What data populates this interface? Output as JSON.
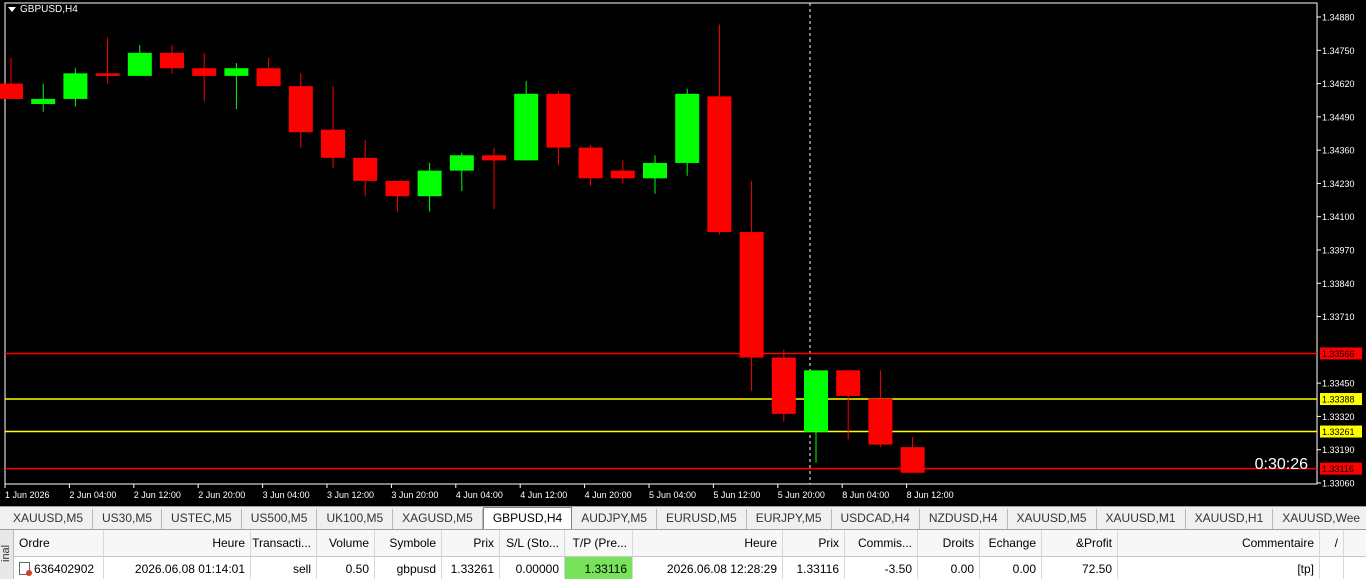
{
  "chart": {
    "title": "GBPUSD,H4",
    "timer": "0:30:26",
    "colors": {
      "bull": "#00ff00",
      "bear": "#ff0000",
      "background": "#000000",
      "grid": "#ffffff"
    }
  },
  "chart_data": {
    "type": "candlestick",
    "symbol": "GBPUSD",
    "timeframe": "H4",
    "ylim": [
      1.3306,
      1.3488
    ],
    "y_ticks": [
      "1.34880",
      "1.34750",
      "1.34620",
      "1.34490",
      "1.34360",
      "1.34230",
      "1.34100",
      "1.33970",
      "1.33840",
      "1.33710",
      "1.33450",
      "1.33320",
      "1.33190",
      "1.33060"
    ],
    "x_tick_labels": [
      {
        "label": "1 Jun 2026",
        "index": 0
      },
      {
        "label": "2 Jun 04:00",
        "index": 2
      },
      {
        "label": "2 Jun 12:00",
        "index": 4
      },
      {
        "label": "2 Jun 20:00",
        "index": 6
      },
      {
        "label": "3 Jun 04:00",
        "index": 8
      },
      {
        "label": "3 Jun 12:00",
        "index": 10
      },
      {
        "label": "3 Jun 20:00",
        "index": 12
      },
      {
        "label": "4 Jun 04:00",
        "index": 14
      },
      {
        "label": "4 Jun 12:00",
        "index": 16
      },
      {
        "label": "4 Jun 20:00",
        "index": 18
      },
      {
        "label": "5 Jun 04:00",
        "index": 20
      },
      {
        "label": "5 Jun 12:00",
        "index": 22
      },
      {
        "label": "5 Jun 20:00",
        "index": 24
      },
      {
        "label": "8 Jun 04:00",
        "index": 26
      },
      {
        "label": "8 Jun 12:00",
        "index": 28
      }
    ],
    "candles": [
      {
        "o": 1.3462,
        "h": 1.3472,
        "l": 1.3456,
        "c": 1.3456
      },
      {
        "o": 1.3454,
        "h": 1.3462,
        "l": 1.3451,
        "c": 1.3456
      },
      {
        "o": 1.3456,
        "h": 1.3468,
        "l": 1.3453,
        "c": 1.3466
      },
      {
        "o": 1.3466,
        "h": 1.348,
        "l": 1.3462,
        "c": 1.3465
      },
      {
        "o": 1.3465,
        "h": 1.3477,
        "l": 1.3465,
        "c": 1.3474
      },
      {
        "o": 1.3474,
        "h": 1.3477,
        "l": 1.3466,
        "c": 1.3468
      },
      {
        "o": 1.3468,
        "h": 1.3474,
        "l": 1.3455,
        "c": 1.3465
      },
      {
        "o": 1.3465,
        "h": 1.347,
        "l": 1.3452,
        "c": 1.3468
      },
      {
        "o": 1.3468,
        "h": 1.3472,
        "l": 1.3461,
        "c": 1.3461
      },
      {
        "o": 1.3461,
        "h": 1.3466,
        "l": 1.3437,
        "c": 1.3443
      },
      {
        "o": 1.3444,
        "h": 1.3461,
        "l": 1.3429,
        "c": 1.3433
      },
      {
        "o": 1.3433,
        "h": 1.344,
        "l": 1.3418,
        "c": 1.3424
      },
      {
        "o": 1.3424,
        "h": 1.3424,
        "l": 1.3412,
        "c": 1.3418
      },
      {
        "o": 1.3418,
        "h": 1.3431,
        "l": 1.3412,
        "c": 1.3428
      },
      {
        "o": 1.3428,
        "h": 1.3435,
        "l": 1.342,
        "c": 1.3434
      },
      {
        "o": 1.3434,
        "h": 1.3437,
        "l": 1.3413,
        "c": 1.3432
      },
      {
        "o": 1.3432,
        "h": 1.3463,
        "l": 1.3432,
        "c": 1.3458
      },
      {
        "o": 1.3458,
        "h": 1.3459,
        "l": 1.343,
        "c": 1.3437
      },
      {
        "o": 1.3437,
        "h": 1.3438,
        "l": 1.3422,
        "c": 1.3425
      },
      {
        "o": 1.3428,
        "h": 1.3432,
        "l": 1.3423,
        "c": 1.3425
      },
      {
        "o": 1.3425,
        "h": 1.3434,
        "l": 1.3419,
        "c": 1.3431
      },
      {
        "o": 1.3431,
        "h": 1.346,
        "l": 1.3426,
        "c": 1.3458
      },
      {
        "o": 1.3457,
        "h": 1.3485,
        "l": 1.3403,
        "c": 1.3404
      },
      {
        "o": 1.3404,
        "h": 1.3424,
        "l": 1.3342,
        "c": 1.3355
      },
      {
        "o": 1.3355,
        "h": 1.3358,
        "l": 1.333,
        "c": 1.3333
      },
      {
        "o": 1.3326,
        "h": 1.335,
        "l": 1.3314,
        "c": 1.335
      },
      {
        "o": 1.335,
        "h": 1.335,
        "l": 1.3323,
        "c": 1.334
      },
      {
        "o": 1.3339,
        "h": 1.335,
        "l": 1.332,
        "c": 1.3321
      },
      {
        "o": 1.332,
        "h": 1.3324,
        "l": 1.331,
        "c": 1.331
      }
    ],
    "levels": [
      {
        "value": "1.33566",
        "color": "#ff0000",
        "label_bg": "#ff0000",
        "label_fg": "#000000"
      },
      {
        "value": "1.33388",
        "color": "#ffff00",
        "label_bg": "#ffff00",
        "label_fg": "#000000"
      },
      {
        "value": "1.33261",
        "color": "#ffff00",
        "label_bg": "#ffff00",
        "label_fg": "#000000"
      },
      {
        "value": "1.33116",
        "color": "#ff0000",
        "label_bg": "#ff0000",
        "label_fg": "#000000"
      }
    ],
    "crosshair_index": 25
  },
  "tabs": [
    {
      "label": "XAUUSD,M5",
      "active": false
    },
    {
      "label": "US30,M5",
      "active": false
    },
    {
      "label": "USTEC,M5",
      "active": false
    },
    {
      "label": "US500,M5",
      "active": false
    },
    {
      "label": "UK100,M5",
      "active": false
    },
    {
      "label": "XAGUSD,M5",
      "active": false
    },
    {
      "label": "GBPUSD,H4",
      "active": true
    },
    {
      "label": "AUDJPY,M5",
      "active": false
    },
    {
      "label": "EURUSD,M5",
      "active": false
    },
    {
      "label": "EURJPY,M5",
      "active": false
    },
    {
      "label": "USDCAD,H4",
      "active": false
    },
    {
      "label": "NZDUSD,H4",
      "active": false
    },
    {
      "label": "XAUUSD,M5",
      "active": false
    },
    {
      "label": "XAUUSD,M1",
      "active": false
    },
    {
      "label": "XAUUSD,H1",
      "active": false
    },
    {
      "label": "XAUUSD,Wee",
      "active": false
    }
  ],
  "terminal": {
    "side_label": "inal",
    "headers": [
      "Ordre",
      "Heure",
      "Transacti...",
      "Volume",
      "Symbole",
      "Prix",
      "S/L (Sto...",
      "T/P (Pre...",
      "Heure",
      "Prix",
      "Commis...",
      "Droits",
      "Echange",
      "&Profit",
      "Commentaire",
      "/"
    ],
    "rows": [
      [
        "636402902",
        "2026.06.08 01:14:01",
        "sell",
        "0.50",
        "gbpusd",
        "1.33261",
        "0.00000",
        "1.33116",
        "2026.06.08 12:28:29",
        "1.33116",
        "-3.50",
        "0.00",
        "0.00",
        "72.50",
        "[tp]",
        ""
      ]
    ]
  }
}
